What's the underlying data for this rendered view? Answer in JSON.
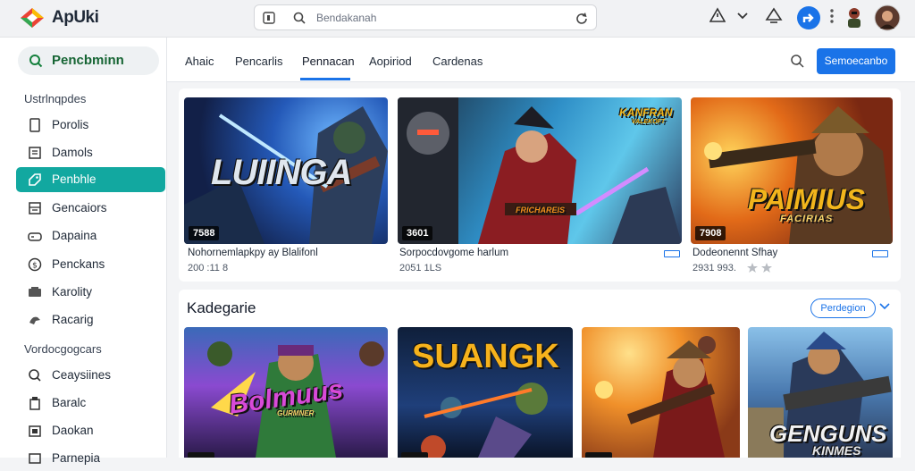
{
  "app": {
    "title": "ApUki"
  },
  "search": {
    "query": "Bendakanah"
  },
  "sidebar": {
    "search_label": "Pencbminn",
    "heading1": "Ustrlnqpdes",
    "items": [
      {
        "label": "Porolis",
        "icon": "document-icon",
        "active": false
      },
      {
        "label": "Damols",
        "icon": "newspaper-icon",
        "active": false
      },
      {
        "label": "Penbhle",
        "icon": "tag-icon",
        "active": true
      },
      {
        "label": "Gencaiors",
        "icon": "grid-icon",
        "active": false
      },
      {
        "label": "Dapaina",
        "icon": "controller-icon",
        "active": false
      },
      {
        "label": "Penckans",
        "icon": "coin-icon",
        "active": false
      },
      {
        "label": "Karolity",
        "icon": "keyboard-icon",
        "active": false
      },
      {
        "label": "Racarig",
        "icon": "race-icon",
        "active": false
      }
    ],
    "heading2": "Vordocgogcars",
    "items2": [
      {
        "label": "Ceaysiines",
        "icon": "search-icon"
      },
      {
        "label": "Baralc",
        "icon": "bag-icon"
      },
      {
        "label": "Daokan",
        "icon": "box-icon"
      },
      {
        "label": "Parnepia",
        "icon": "device-icon"
      }
    ]
  },
  "tabs": [
    {
      "label": "Ahaic",
      "active": false
    },
    {
      "label": "Pencarlis",
      "active": false
    },
    {
      "label": "Pennacan",
      "active": true
    },
    {
      "label": "Aopiriod",
      "active": false
    },
    {
      "label": "Cardenas",
      "active": false
    }
  ],
  "cta_label": "Semoecanbo",
  "featured": [
    {
      "badge": "7588",
      "title": "Nohornemlapkpy ay Blalifonl",
      "meta": "200 :11 8",
      "art": "LUIINGA"
    },
    {
      "badge": "3601",
      "title": "Sorpocdovgome harlum",
      "meta": "2051 1LS",
      "art": "KANFRAN"
    },
    {
      "badge": "7908",
      "title": "Dodeonennt Sfhay",
      "meta": "2931 993.",
      "art": "PAIMIUS",
      "sub": "FACIRIAS"
    }
  ],
  "art_captions": {
    "kanfran_sub": "VALEKOFT",
    "banner": "FRICHAREIS"
  },
  "section": {
    "title": "Kadegarie",
    "pill": "Perdegion",
    "games": [
      {
        "art": "Bolmuus",
        "sub": "GURMNER"
      },
      {
        "art": "SUANGK"
      },
      {
        "art": ""
      },
      {
        "art": "GENGUNS",
        "sub": "KINMES"
      }
    ]
  },
  "colors": {
    "accent": "#1a73e8",
    "active_item": "#12a8a0"
  }
}
